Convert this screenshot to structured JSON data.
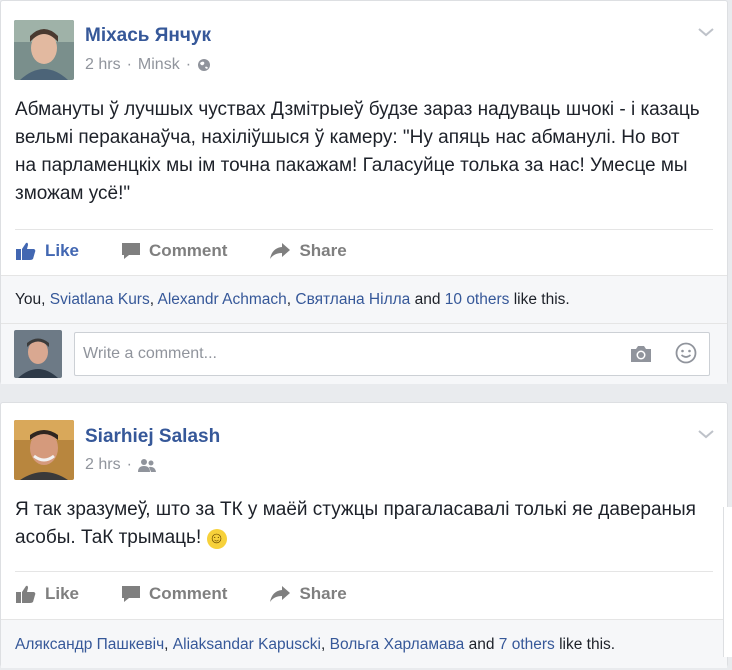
{
  "posts": [
    {
      "author": "Міхась Янчук",
      "time": "2 hrs",
      "location": "Minsk",
      "audience_icon": "globe-icon",
      "text": "Абмануты ў лучшых чуствах Дзмітрыеў будзе зараз надуваць шчокі - і казаць вельмі пераканаўча, нахіліўшыся ў камеру: \"Ну апяць нас абманулі. Но вот на парламенцкіх мы ім точна пакажам! Галасуйце толька за нас! Умесце мы зможам усё!\"",
      "actions": {
        "like": "Like",
        "comment": "Comment",
        "share": "Share"
      },
      "like_active": true,
      "likes": {
        "you": "You",
        "sep": ", ",
        "name1": "Sviatlana Kurs",
        "name2": "Alexandr Achmach",
        "name3": "Святлана Нілла",
        "and": " and ",
        "others": "10 others",
        "suffix": " like this."
      },
      "comment_placeholder": "Write a comment..."
    },
    {
      "author": "Siarhiej Salash",
      "time": "2 hrs",
      "audience_icon": "friends-icon",
      "text": "Я так зразумеў, што за ТК у маёй стужцы прагаласавалі толькі яе давераныя асобы. ТаК трымаць!",
      "emoji": "☺",
      "actions": {
        "like": "Like",
        "comment": "Comment",
        "share": "Share"
      },
      "like_active": false,
      "likes": {
        "name1": "Аляксандр Пашкевіч",
        "sep": ", ",
        "name2": "Aliaksandar Kapuscki",
        "name3": "Вольга Харламава",
        "and": " and ",
        "others": "7 others",
        "suffix": " like this."
      }
    }
  ],
  "colors": {
    "link": "#365899",
    "like_active": "#4267b2",
    "muted": "#90949c",
    "action": "#7f7f7f",
    "background": "#e9ebee"
  }
}
